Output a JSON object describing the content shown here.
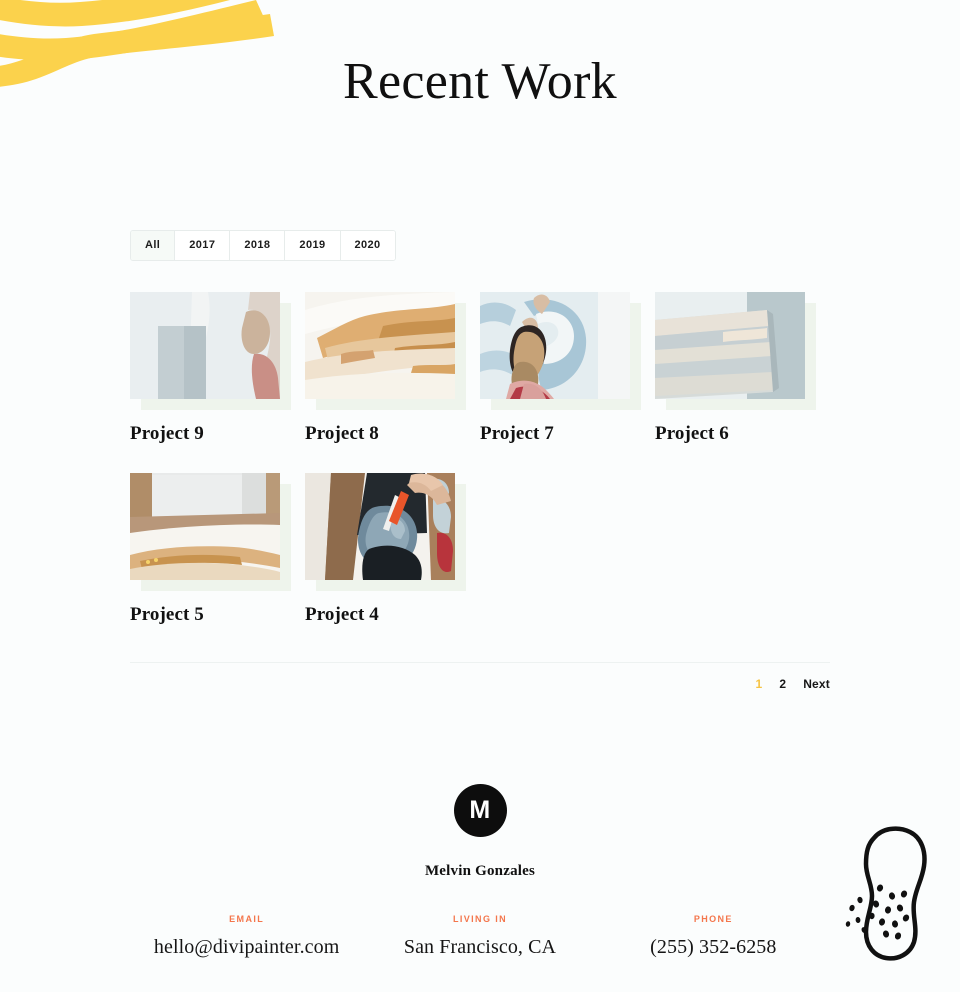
{
  "page": {
    "title": "Recent Work",
    "background_color": "#fbfdfd",
    "accent_yellow": "#fbd24c",
    "accent_orange": "#f4764c"
  },
  "decor": {
    "brush_top_left_name": "yellow-brush-strokes",
    "sponge_bottom_right_name": "sponge-illustration"
  },
  "filters": {
    "items": [
      {
        "label": "All",
        "active": true
      },
      {
        "label": "2017",
        "active": false
      },
      {
        "label": "2018",
        "active": false
      },
      {
        "label": "2019",
        "active": false
      },
      {
        "label": "2020",
        "active": false
      }
    ]
  },
  "projects": [
    {
      "title": "Project 9",
      "thumb": "vase-grey-block"
    },
    {
      "title": "Project 8",
      "thumb": "ochre-abstract-wash"
    },
    {
      "title": "Project 7",
      "thumb": "woman-painting-blue-circle"
    },
    {
      "title": "Project 6",
      "thumb": "grey-blue-canvas"
    },
    {
      "title": "Project 5",
      "thumb": "floor-watercolor-sheet"
    },
    {
      "title": "Project 4",
      "thumb": "hand-brush-blue-paint"
    }
  ],
  "pagination": {
    "pages": [
      {
        "label": "1",
        "current": true
      },
      {
        "label": "2",
        "current": false
      }
    ],
    "next_label": "Next"
  },
  "footer": {
    "logo_letter": "M",
    "name": "Melvin Gonzales",
    "contacts": [
      {
        "label": "Email",
        "value": "hello@divipainter.com"
      },
      {
        "label": "Living In",
        "value": "San Francisco, CA"
      },
      {
        "label": "Phone",
        "value": "(255) 352-6258"
      }
    ]
  }
}
